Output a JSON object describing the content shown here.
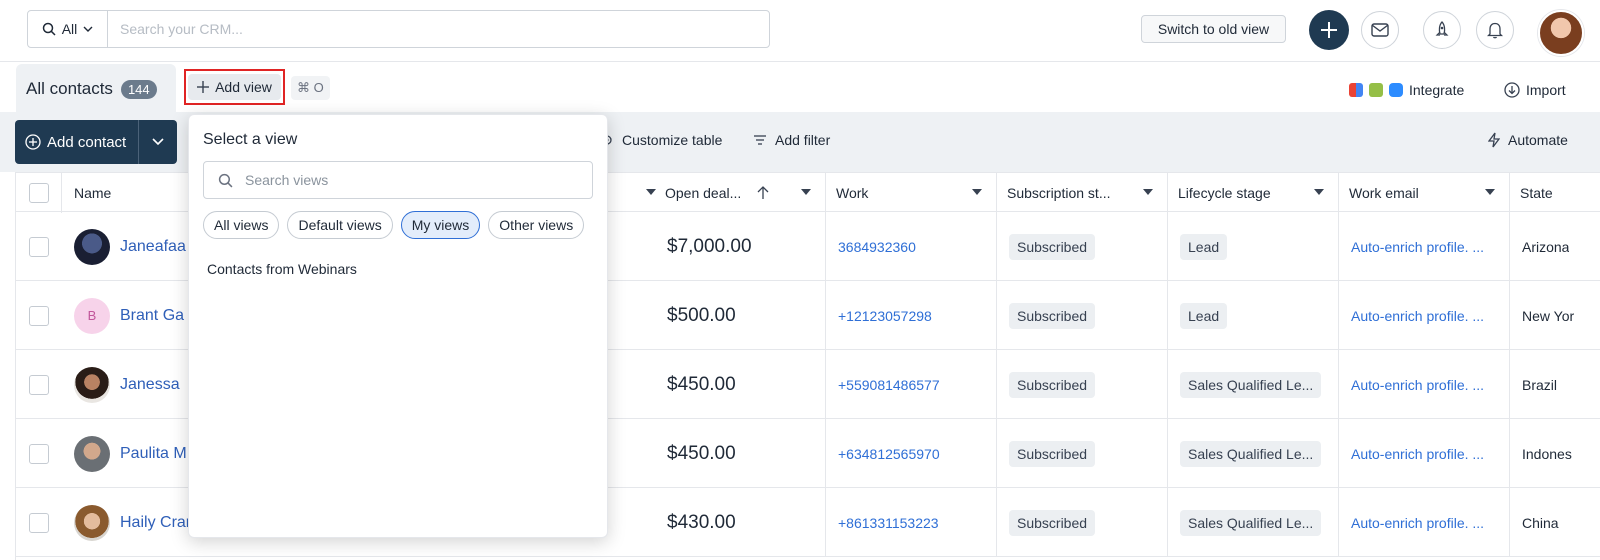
{
  "topbar": {
    "search_scope": "All",
    "search_placeholder": "Search your CRM...",
    "switch_label": "Switch to old view"
  },
  "viewbar": {
    "tab_label": "All contacts",
    "tab_count": "144",
    "add_view_label": "Add view",
    "shortcut": "⌘ O",
    "integrate_label": "Integrate",
    "import_label": "Import"
  },
  "actionbar": {
    "add_contact_label": "Add contact",
    "customize_label": "Customize table",
    "filter_label": "Add filter",
    "automate_label": "Automate"
  },
  "table": {
    "columns": {
      "name": "Name",
      "open_deals": "Open deal...",
      "work": "Work",
      "subscription": "Subscription st...",
      "lifecycle": "Lifecycle stage",
      "work_email": "Work email",
      "state": "State"
    },
    "rows": [
      {
        "name": "Janeafaa",
        "amount": "$7,000.00",
        "phone": "3684932360",
        "subscription": "Subscribed",
        "lifecycle": "Lead",
        "email": "Auto-enrich profile. ...",
        "state": "Arizona"
      },
      {
        "name": "Brant Ga",
        "initial": "B",
        "amount": "$500.00",
        "phone": "+12123057298",
        "subscription": "Subscribed",
        "lifecycle": "Lead",
        "email": "Auto-enrich profile. ...",
        "state": "New Yor"
      },
      {
        "name": "Janessa",
        "amount": "$450.00",
        "phone": "+559081486577",
        "subscription": "Subscribed",
        "lifecycle": "Sales Qualified Le...",
        "email": "Auto-enrich profile. ...",
        "state": "Brazil"
      },
      {
        "name": "Paulita M",
        "amount": "$450.00",
        "phone": "+634812565970",
        "subscription": "Subscribed",
        "lifecycle": "Sales Qualified Le...",
        "email": "Auto-enrich profile. ...",
        "state": "Indones"
      },
      {
        "name": "Haily Cramer",
        "amount": "$430.00",
        "phone": "+861331153223",
        "subscription": "Subscribed",
        "lifecycle": "Sales Qualified Le...",
        "email": "Auto-enrich profile. ...",
        "state": "China"
      }
    ]
  },
  "dropdown": {
    "title": "Select a view",
    "search_placeholder": "Search views",
    "chips": [
      "All views",
      "Default views",
      "My views",
      "Other views"
    ],
    "active_chip": "My views",
    "items": [
      "Contacts from Webinars"
    ]
  },
  "colors": {
    "primary": "#1f3a52",
    "link": "#2f6fd6",
    "highlight_border": "#e02424"
  }
}
